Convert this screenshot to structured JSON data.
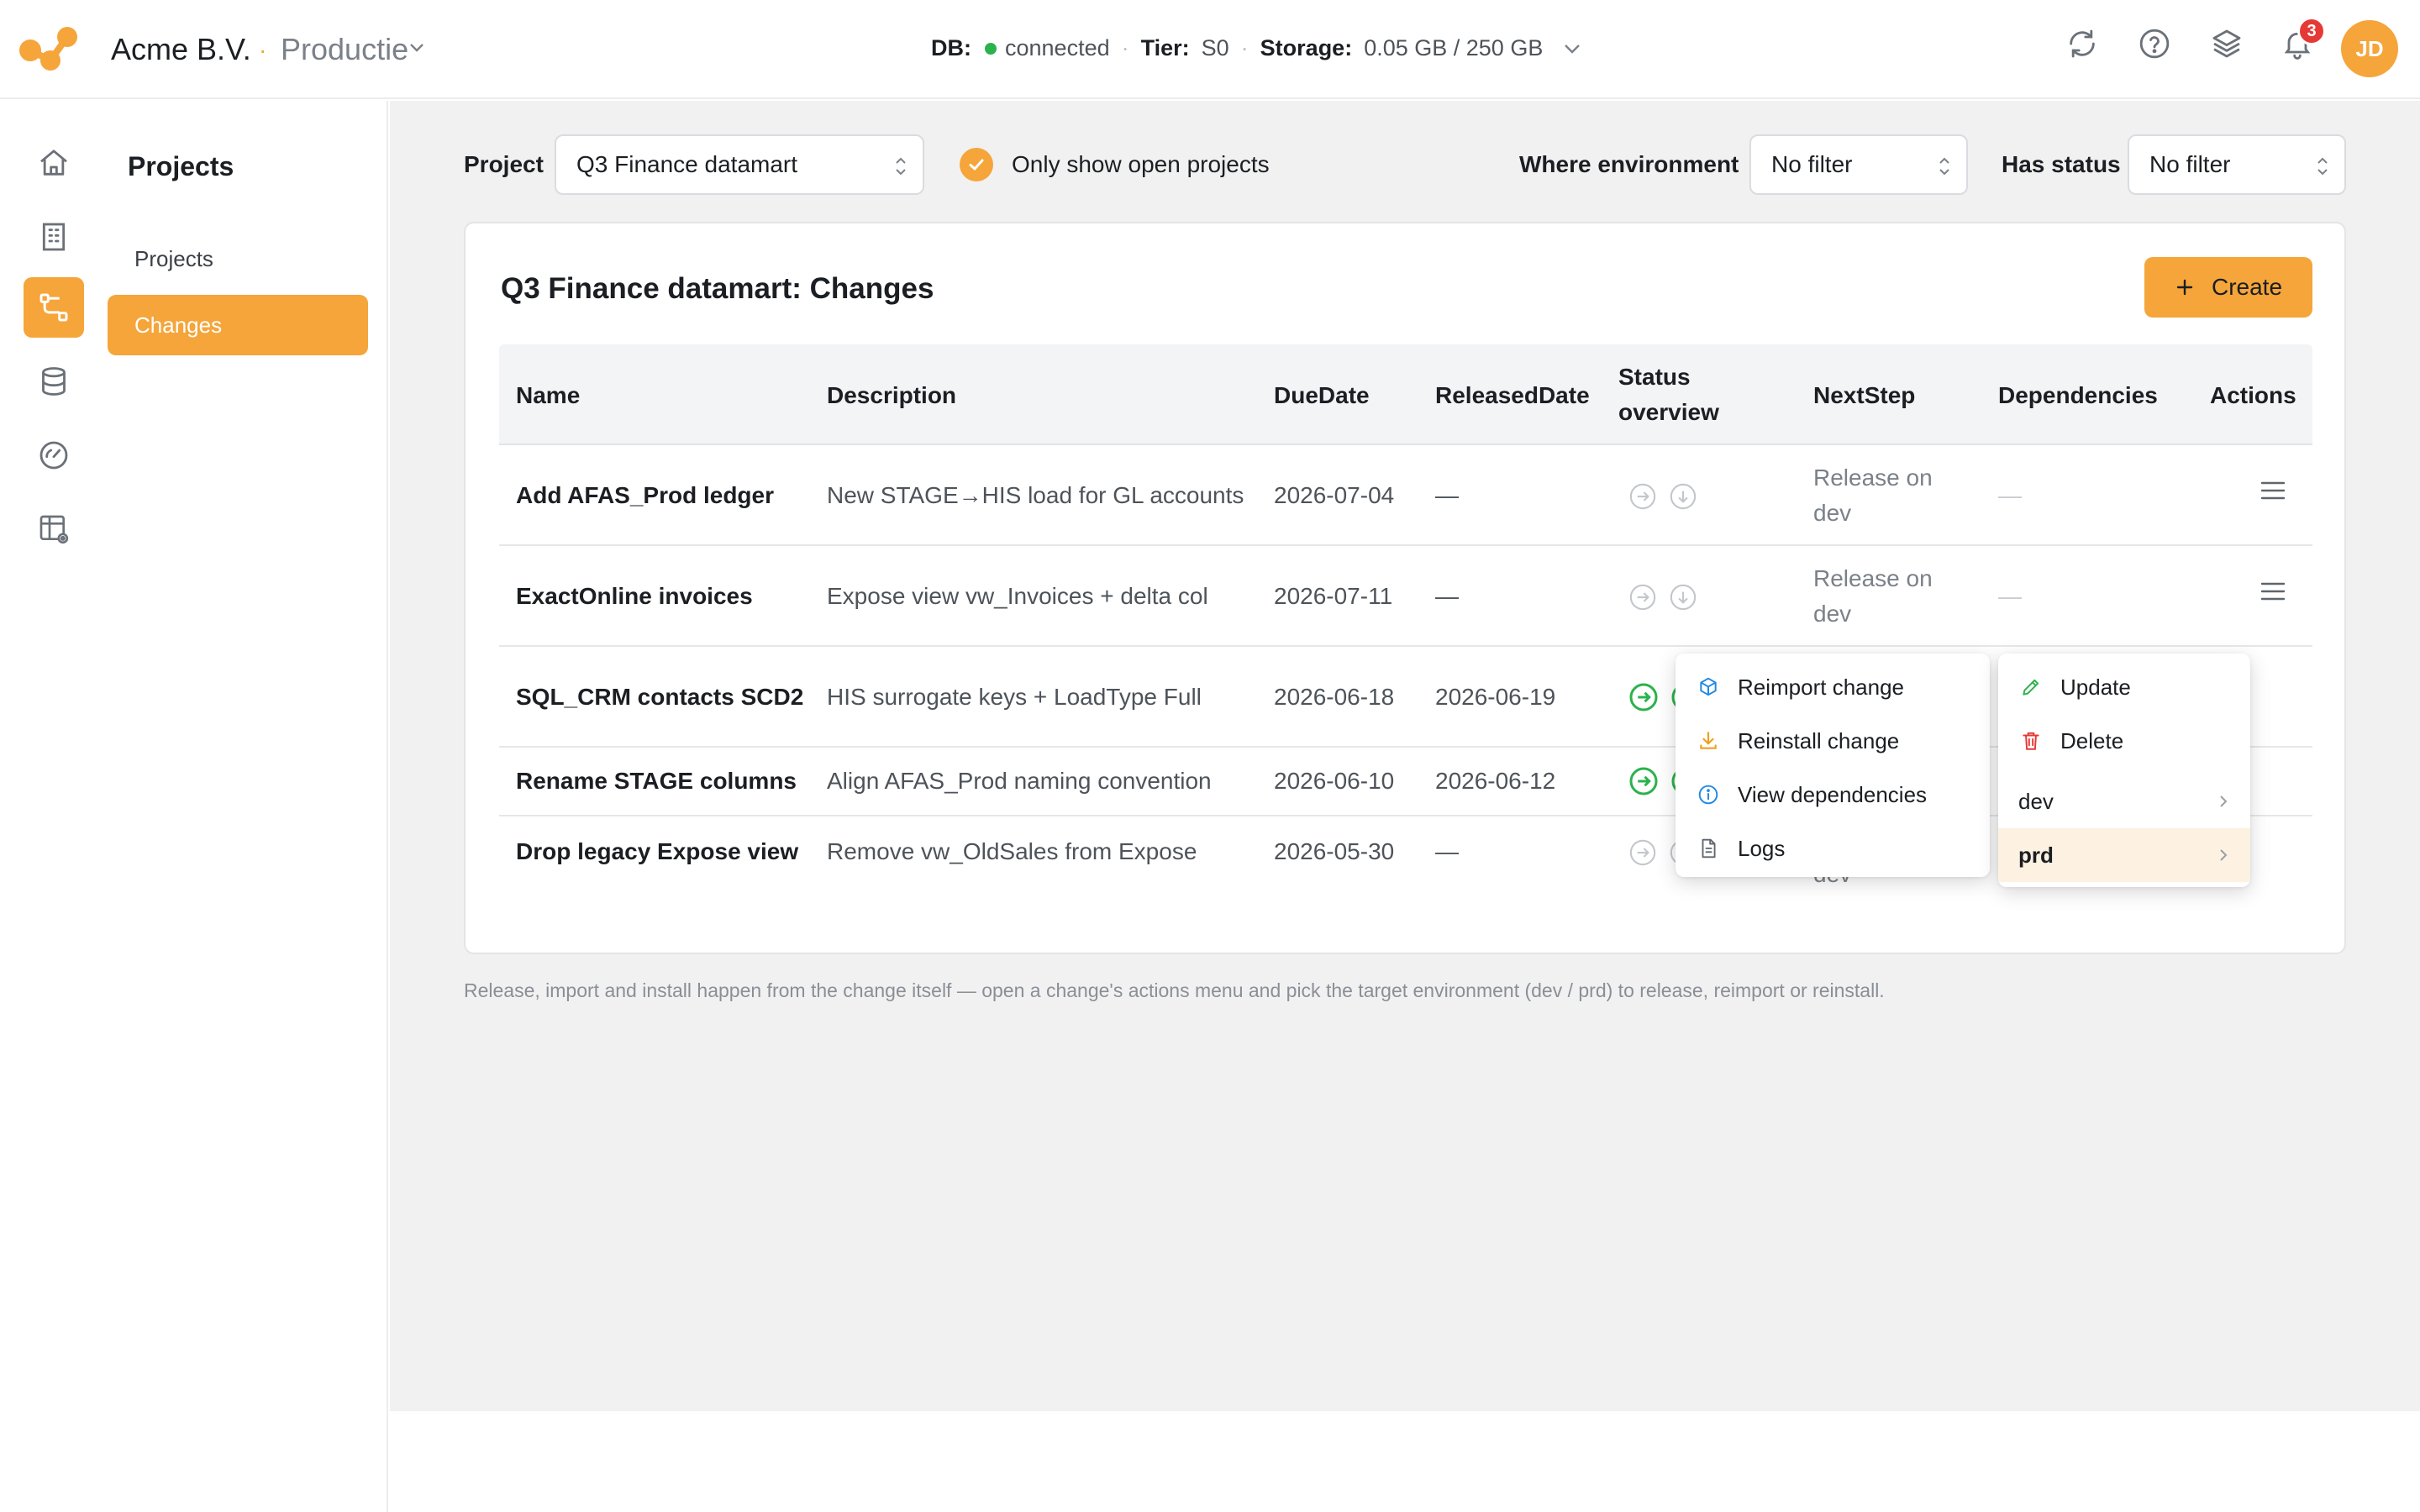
{
  "header": {
    "org_name": "Acme B.V.",
    "separator": "·",
    "environment": "Productie",
    "db_label": "DB:",
    "db_status": "connected",
    "tier_label": "Tier:",
    "tier_value": "S0",
    "storage_label": "Storage:",
    "storage_value": "0.05 GB / 250 GB",
    "notifications_count": "3",
    "avatar_initials": "JD"
  },
  "subnav": {
    "title": "Projects",
    "items": [
      {
        "label": "Projects"
      },
      {
        "label": "Changes"
      }
    ]
  },
  "filters": {
    "project_label": "Project",
    "project_value": "Q3 Finance datamart",
    "open_only_label": "Only show open projects",
    "environment_label": "Where environment",
    "environment_value": "No filter",
    "status_label": "Has status",
    "status_value": "No filter"
  },
  "card": {
    "title": "Q3 Finance datamart: Changes",
    "create_label": "Create"
  },
  "table": {
    "columns": {
      "name": "Name",
      "description": "Description",
      "due": "DueDate",
      "released": "ReleasedDate",
      "status_1": "Status",
      "status_2": "overview",
      "next": "NextStep",
      "deps": "Dependencies",
      "actions": "Actions"
    },
    "rows": [
      {
        "name": "Add AFAS_Prod ledger",
        "description": "New STAGE→HIS load for GL accounts",
        "due": "2026-07-04",
        "released": "—",
        "next_1": "Release on",
        "next_2": "dev",
        "deps": "—"
      },
      {
        "name": "ExactOnline invoices",
        "description": "Expose view vw_Invoices + delta col",
        "due": "2026-07-11",
        "released": "—",
        "next_1": "Release on",
        "next_2": "dev",
        "deps": "—"
      },
      {
        "name": "SQL_CRM contacts SCD2",
        "description": "HIS surrogate keys + LoadType Full",
        "due": "2026-06-18",
        "released": "2026-06-19",
        "next_1": "",
        "next_2": "",
        "deps": ""
      },
      {
        "name": "Rename STAGE columns",
        "description": "Align AFAS_Prod naming convention",
        "due": "2026-06-10",
        "released": "2026-06-12",
        "next_1": "",
        "next_2": "",
        "deps": ""
      },
      {
        "name": "Drop legacy Expose view",
        "description": "Remove vw_OldSales from Expose",
        "due": "2026-05-30",
        "released": "—",
        "next_1": "",
        "next_2": "dev",
        "deps": ""
      }
    ]
  },
  "context_menu": {
    "items": [
      {
        "label": "Reimport change",
        "icon": "cube-refresh-icon"
      },
      {
        "label": "Reinstall change",
        "icon": "download-icon"
      },
      {
        "label": "View dependencies",
        "icon": "info-icon"
      },
      {
        "label": "Logs",
        "icon": "document-icon"
      }
    ]
  },
  "actions_menu": {
    "items": [
      {
        "label": "Update",
        "icon": "pencil-icon"
      },
      {
        "label": "Delete",
        "icon": "trash-icon"
      },
      {
        "label": "dev"
      },
      {
        "label": "prd"
      }
    ]
  },
  "footnote": "Release, import and install happen from the change itself — open a change's actions menu and pick the target environment (dev / prd) to release, reimport or reinstall.",
  "colors": {
    "accent": "#f5a53a",
    "success": "#2bb24c",
    "danger": "#e53935",
    "info": "#1e88e5"
  }
}
